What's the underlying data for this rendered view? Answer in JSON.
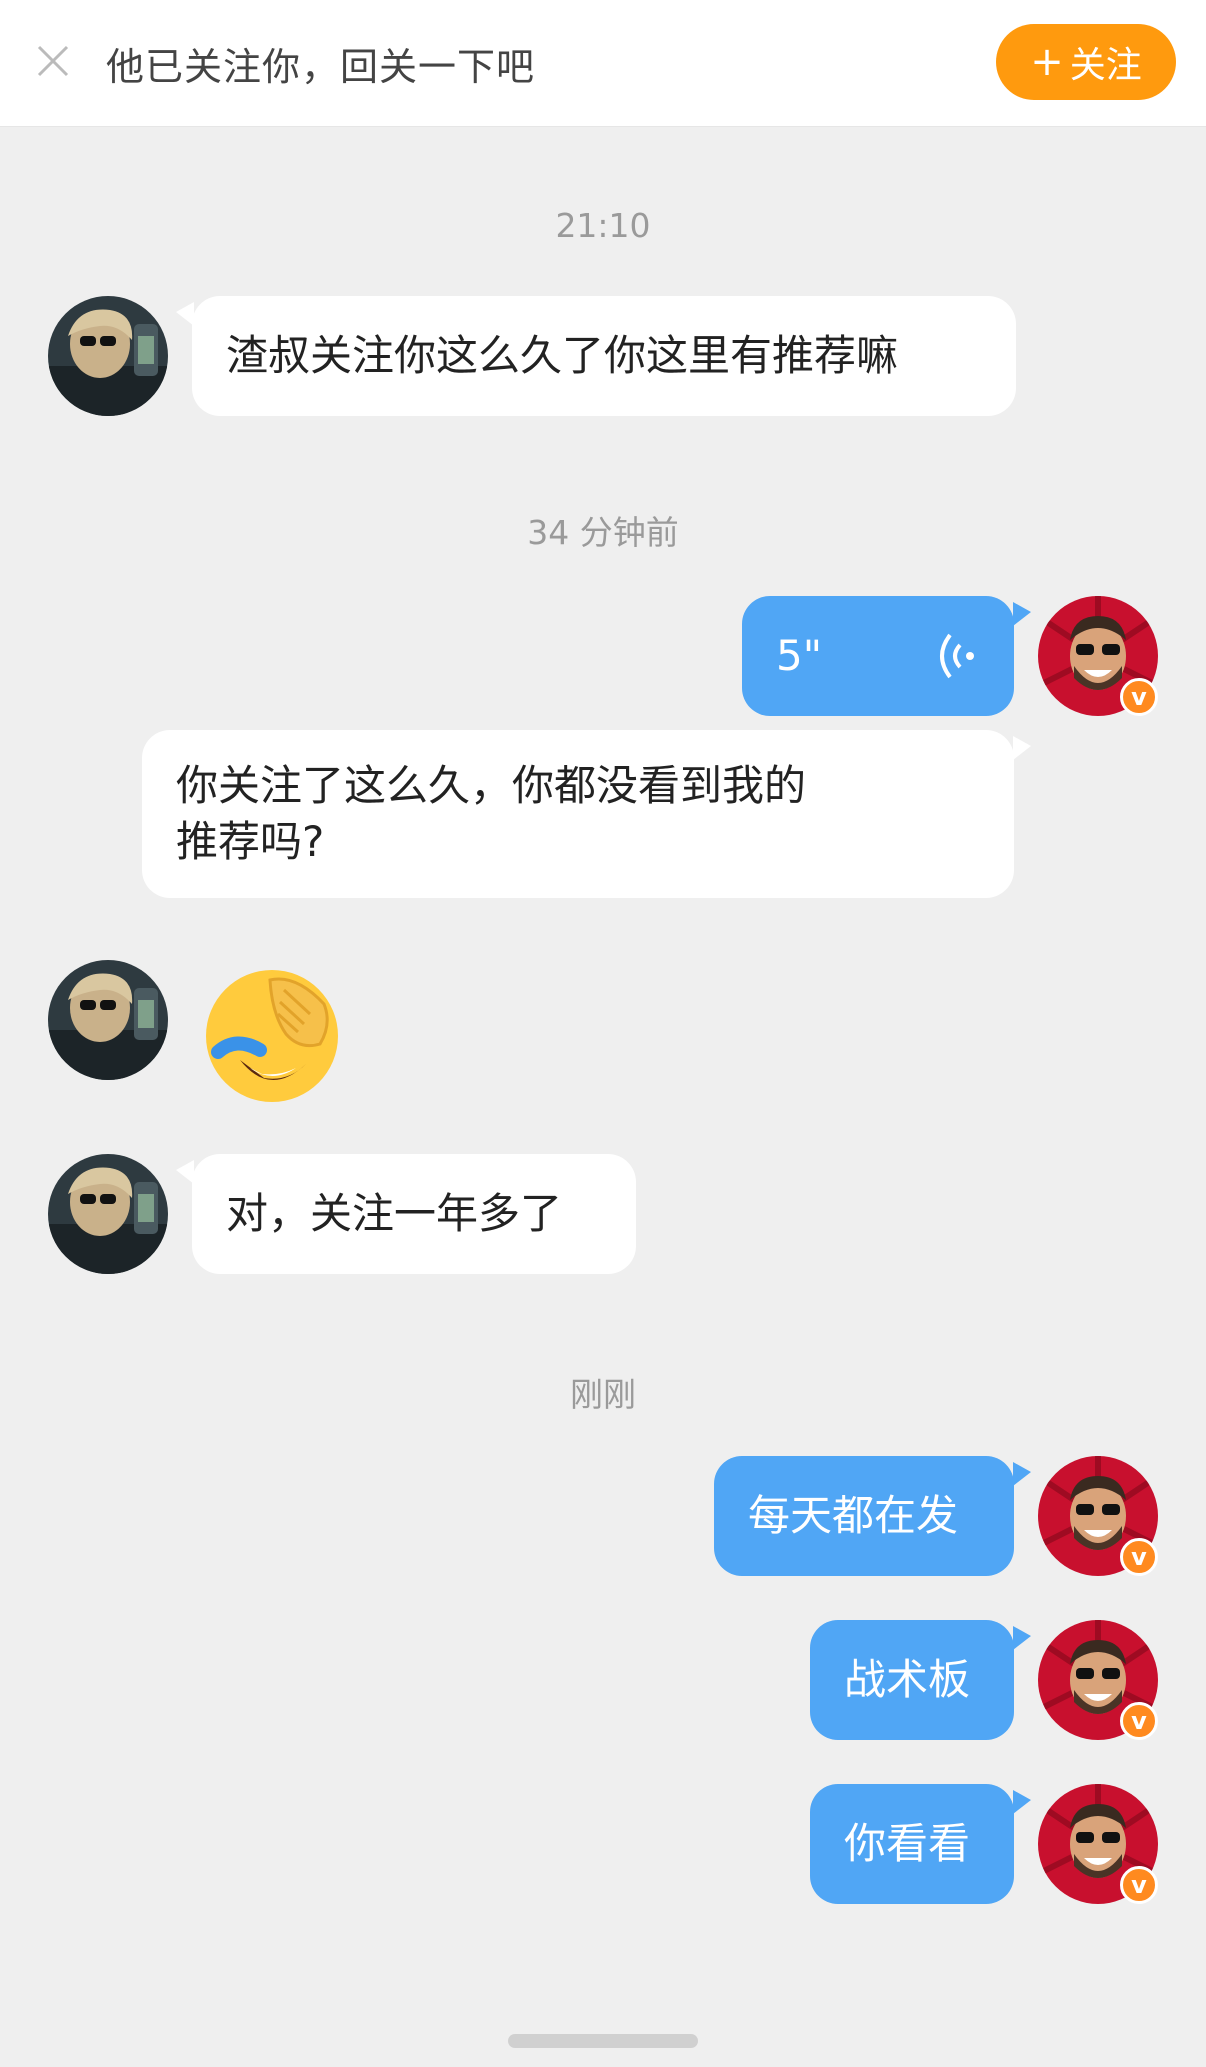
{
  "header": {
    "hint_text": "他已关注你，回关一下吧",
    "follow_plus": "+",
    "follow_label": "关注"
  },
  "timestamps": [
    "21:10",
    "34 分钟前",
    "刚刚"
  ],
  "messages": [
    {
      "side": "in",
      "type": "text",
      "text": "渣叔关注你这么久了你这里有推荐嘛"
    },
    {
      "side": "out",
      "type": "voice",
      "duration": "5\""
    },
    {
      "side": "out",
      "type": "text",
      "text_line1": "你关注了这么久，你都没看到我的",
      "text_line2": "推荐吗?"
    },
    {
      "side": "in",
      "type": "emoji",
      "emoji": "facepalm-laughing"
    },
    {
      "side": "in",
      "type": "text",
      "text": "对，关注一年多了"
    },
    {
      "side": "out",
      "type": "text",
      "text": "每天都在发"
    },
    {
      "side": "out",
      "type": "text",
      "text": "战术板"
    },
    {
      "side": "out",
      "type": "text",
      "text": "你看看"
    }
  ],
  "verified_badge": "v",
  "colors": {
    "background": "#efefef",
    "incoming_bubble": "#ffffff",
    "outgoing_bubble": "#50a6f5",
    "follow_button": "#ff9a0e",
    "verified_badge": "#ff8a1f"
  }
}
